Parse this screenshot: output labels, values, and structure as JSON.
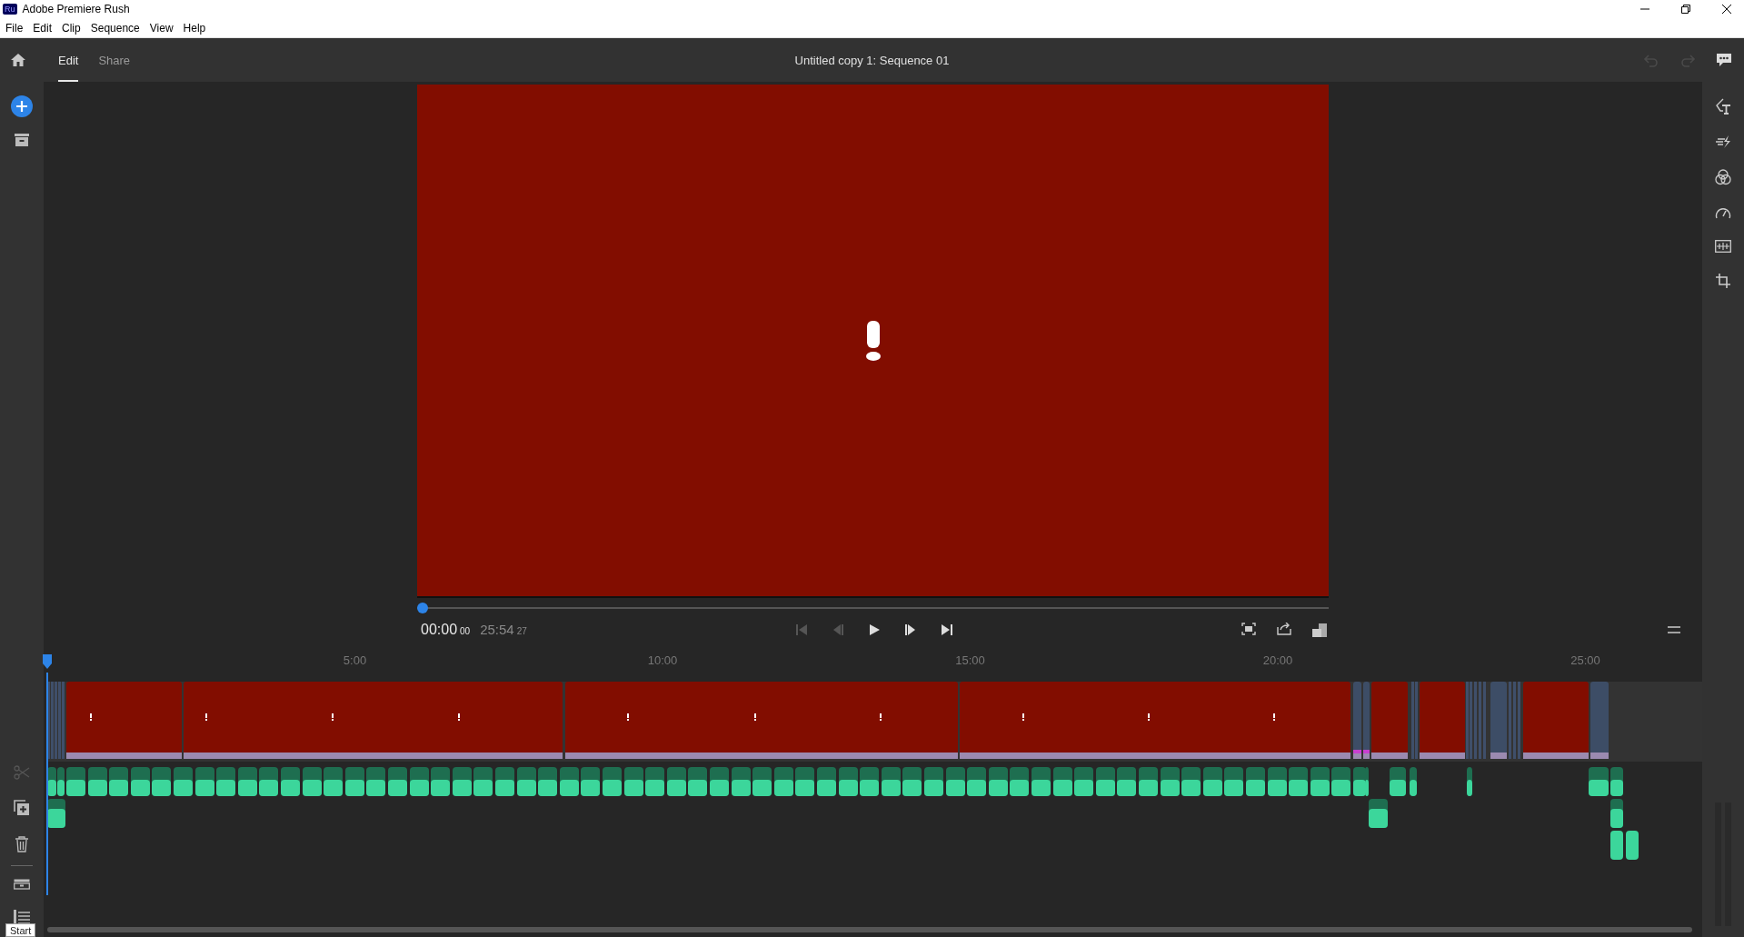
{
  "window": {
    "app_icon": "Ru",
    "title": "Adobe Premiere Rush"
  },
  "menu": [
    "File",
    "Edit",
    "Clip",
    "Sequence",
    "View",
    "Help"
  ],
  "header": {
    "tabs": [
      {
        "label": "Edit",
        "selected": true
      },
      {
        "label": "Share",
        "selected": false
      }
    ],
    "title": "Untitled copy 1: Sequence 01",
    "undo_disabled": true,
    "redo_disabled": true
  },
  "left_tools": [
    {
      "kind": "split",
      "disabled": true
    },
    {
      "kind": "duplicate",
      "disabled": false
    },
    {
      "kind": "delete",
      "disabled": false
    }
  ],
  "player": {
    "scrubber": {
      "level": 0
    },
    "timecode": "00:00",
    "frames": "00",
    "duration": "25:54",
    "duration_frames": "27"
  },
  "ruler": [
    "5:00",
    "10:00",
    "15:00",
    "20:00",
    "25:00"
  ],
  "tooltip": "Start"
}
